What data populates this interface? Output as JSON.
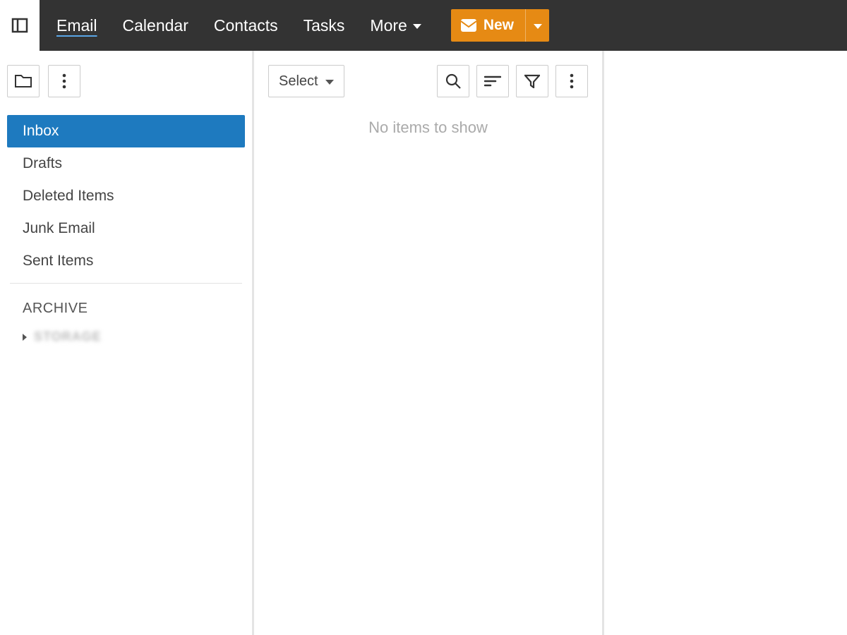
{
  "header": {
    "nav": {
      "email": "Email",
      "calendar": "Calendar",
      "contacts": "Contacts",
      "tasks": "Tasks",
      "more": "More"
    },
    "new_button": "New"
  },
  "sidebar": {
    "folders": [
      {
        "label": "Inbox",
        "active": true
      },
      {
        "label": "Drafts",
        "active": false
      },
      {
        "label": "Deleted Items",
        "active": false
      },
      {
        "label": "Junk Email",
        "active": false
      },
      {
        "label": "Sent Items",
        "active": false
      }
    ],
    "archive_header": "ARCHIVE",
    "storage_header": "STORAGE"
  },
  "list": {
    "select_label": "Select",
    "empty_message": "No items to show"
  }
}
